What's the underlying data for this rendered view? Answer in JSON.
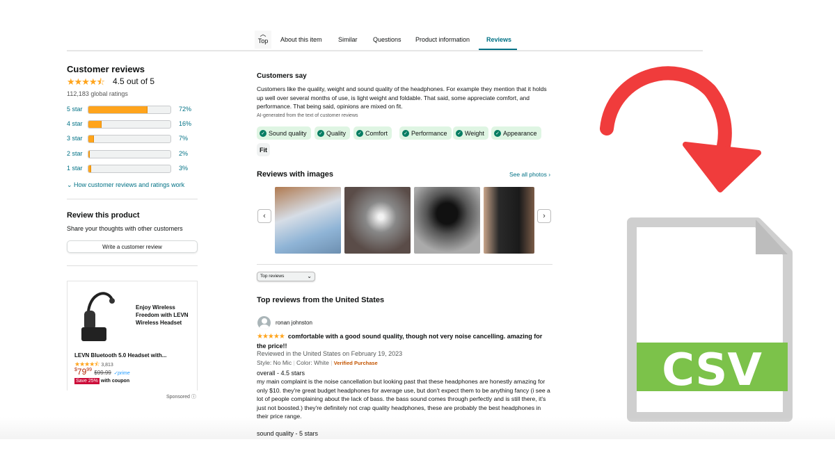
{
  "nav": {
    "top_label": "Top",
    "tabs": [
      "About this item",
      "Similar",
      "Questions",
      "Product information",
      "Reviews"
    ],
    "active": "Reviews"
  },
  "summary": {
    "title": "Customer reviews",
    "stars": "★★★★⯪",
    "rating": "4.5 out of 5",
    "global": "112,183 global ratings",
    "rows": [
      {
        "label": "5 star",
        "pct": "72%",
        "value": 72
      },
      {
        "label": "4 star",
        "pct": "16%",
        "value": 16
      },
      {
        "label": "3 star",
        "pct": "7%",
        "value": 7
      },
      {
        "label": "2 star",
        "pct": "2%",
        "value": 2
      },
      {
        "label": "1 star",
        "pct": "3%",
        "value": 3
      }
    ],
    "how": "How customer reviews and ratings work"
  },
  "review_product": {
    "title": "Review this product",
    "sub": "Share your thoughts with other customers",
    "button": "Write a customer review"
  },
  "ad": {
    "tagline": "Enjoy Wireless Freedom with LEVN Wireless Headset",
    "name": "LEVN Bluetooth 5.0 Headset with...",
    "stars": "★★★★⯪",
    "count": "3,813",
    "price_dollars": "79",
    "price_cents": "99",
    "list_price": "$99.99",
    "prime": "✓prime",
    "save": "Save 25%",
    "coupon": "with coupon",
    "sponsored": "Sponsored"
  },
  "customers_say": {
    "title": "Customers say",
    "text": "Customers like the quality, weight and sound quality of the headphones. For example they mention that it holds up well over several months of use, is light weight and foldable. That said, some appreciate comfort, and performance. That being said, opinions are mixed on fit.",
    "ai_note": "AI-generated from the text of customer reviews",
    "chips": [
      "Sound quality",
      "Quality",
      "Comfort",
      "Performance",
      "Weight",
      "Appearance"
    ],
    "neutral_chip": "Fit"
  },
  "images": {
    "title": "Reviews with images",
    "see_all": "See all photos ›"
  },
  "sort": {
    "value": "Top reviews"
  },
  "top_reviews": {
    "title": "Top reviews from the United States",
    "review": {
      "author": "ronan johnston",
      "stars": "★★★★★",
      "headline": "comfortable with a good sound quality, though not very noise cancelling. amazing for the price!!",
      "meta": "Reviewed in the United States on February 19, 2023",
      "style": "Style: No Mic",
      "color": "Color: White",
      "verified": "Verified Purchase",
      "overall": "overall - 4.5 stars",
      "body": "my main complaint is the noise cancellation but looking past that these headphones are honestly amazing for only $10. they're great budget headphones for average use, but don't expect them to be anything fancy (i see a lot of people complaining about the lack of bass. the bass sound comes through perfectly and is still there, it's just not boosted.) they're definitely not crap quality headphones, these are probably the best headphones in their price range.",
      "sound": "sound quality - 5 stars"
    }
  },
  "csv_icon": {
    "label": "CSV",
    "band_color": "#7cc24a",
    "arrow_color": "#f03c3c"
  }
}
